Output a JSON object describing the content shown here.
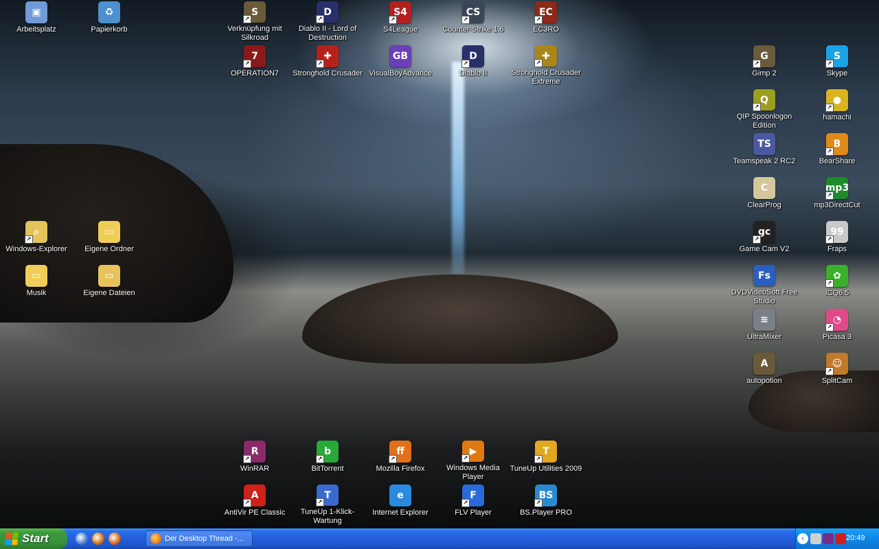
{
  "desktop": {
    "icons": [
      {
        "label": "Arbeitsplatz",
        "glyph": "▣",
        "color": "#6f9bd8",
        "shortcut": false
      },
      {
        "label": "Papierkorb",
        "glyph": "♻",
        "color": "#4e8fd1",
        "shortcut": false
      },
      {
        "label": "Verknüpfung mit Silkroad",
        "glyph": "S",
        "color": "#6b5a3a",
        "shortcut": true
      },
      {
        "label": "Diablo II - Lord of Destruction",
        "glyph": "D",
        "color": "#28306a",
        "shortcut": true
      },
      {
        "label": "S4League",
        "glyph": "S4",
        "color": "#b2211f",
        "shortcut": true
      },
      {
        "label": "Counter-Strike 1.6",
        "glyph": "CS",
        "color": "#3a4658",
        "shortcut": true
      },
      {
        "label": "EC3RO",
        "glyph": "EC",
        "color": "#8c2a18",
        "shortcut": true
      },
      {
        "label": "OPERATION7",
        "glyph": "7",
        "color": "#8a1a1a",
        "shortcut": true
      },
      {
        "label": "Stronghold Crusader",
        "glyph": "✚",
        "color": "#b5221b",
        "shortcut": true
      },
      {
        "label": "VisualBoyAdvance",
        "glyph": "GB",
        "color": "#6a3fb8",
        "shortcut": false
      },
      {
        "label": "Diablo II",
        "glyph": "D",
        "color": "#28306a",
        "shortcut": true
      },
      {
        "label": "Stronghold Crusader Extreme",
        "glyph": "✚",
        "color": "#a8871c",
        "shortcut": true
      },
      {
        "label": "Gimp 2",
        "glyph": "G",
        "color": "#6b5a3c",
        "shortcut": true
      },
      {
        "label": "Skype",
        "glyph": "S",
        "color": "#1aa3e6",
        "shortcut": true
      },
      {
        "label": "QIP Spoonlogon Edition",
        "glyph": "Q",
        "color": "#9aa01e",
        "shortcut": true
      },
      {
        "label": "hamachi",
        "glyph": "●",
        "color": "#d9b320",
        "shortcut": true
      },
      {
        "label": "Teamspeak 2 RC2",
        "glyph": "TS",
        "color": "#4a5aa0",
        "shortcut": false
      },
      {
        "label": "BearShare",
        "glyph": "B",
        "color": "#e08a18",
        "shortcut": true
      },
      {
        "label": "ClearProg",
        "glyph": "C",
        "color": "#d6c79a",
        "shortcut": false
      },
      {
        "label": "mp3DirectCut",
        "glyph": "mp3",
        "color": "#1e8a2a",
        "shortcut": true
      },
      {
        "label": "Windows-Explorer",
        "glyph": "⌕",
        "color": "#e3c45a",
        "shortcut": true
      },
      {
        "label": "Eigene Ordner",
        "glyph": "▭",
        "color": "#f0cd58",
        "shortcut": false
      },
      {
        "label": "Game Cam V2",
        "glyph": "gc",
        "color": "#222222",
        "shortcut": true
      },
      {
        "label": "Fraps",
        "glyph": "99",
        "color": "#c9c9c9",
        "shortcut": true
      },
      {
        "label": "Musik",
        "glyph": "▭",
        "color": "#f0cd58",
        "shortcut": false
      },
      {
        "label": "Eigene Dateien",
        "glyph": "▭",
        "color": "#e8c35c",
        "shortcut": false
      },
      {
        "label": "DVDVideoSoft Free Studio",
        "glyph": "Fs",
        "color": "#2a5fc0",
        "shortcut": false
      },
      {
        "label": "ICQ6.5",
        "glyph": "✿",
        "color": "#3ab02a",
        "shortcut": true
      },
      {
        "label": "UltraMixer",
        "glyph": "≋",
        "color": "#7a7f88",
        "shortcut": false
      },
      {
        "label": "Picasa 3",
        "glyph": "◔",
        "color": "#e04a8a",
        "shortcut": true
      },
      {
        "label": "autopotion",
        "glyph": "A",
        "color": "#6b5a3a",
        "shortcut": false
      },
      {
        "label": "SplitCam",
        "glyph": "☺",
        "color": "#c07a2a",
        "shortcut": true
      },
      {
        "label": "WinRAR",
        "glyph": "R",
        "color": "#8a2a6a",
        "shortcut": true
      },
      {
        "label": "BitTorrent",
        "glyph": "b",
        "color": "#2aa83a",
        "shortcut": true
      },
      {
        "label": "Mozilla Firefox",
        "glyph": "ff",
        "color": "#e0701a",
        "shortcut": true
      },
      {
        "label": "Windows Media Player",
        "glyph": "▶",
        "color": "#e07a10",
        "shortcut": true
      },
      {
        "label": "TuneUp Utilities 2009",
        "glyph": "T",
        "color": "#e0a820",
        "shortcut": true
      },
      {
        "label": "AntiVir PE Classic",
        "glyph": "A",
        "color": "#d0201a",
        "shortcut": true
      },
      {
        "label": "TuneUp 1-Klick-Wartung",
        "glyph": "T",
        "color": "#3a6ad0",
        "shortcut": true
      },
      {
        "label": "Internet Explorer",
        "glyph": "e",
        "color": "#2a8ae0",
        "shortcut": false
      },
      {
        "label": "FLV Player",
        "glyph": "F",
        "color": "#2a6ad8",
        "shortcut": true
      },
      {
        "label": "BS.Player PRO",
        "glyph": "BS",
        "color": "#2a8ad0",
        "shortcut": true
      }
    ]
  },
  "taskbar": {
    "start_label": "Start",
    "quick_launch": [
      {
        "name": "show-desktop",
        "color": "#5a8ad8"
      },
      {
        "name": "windows-media-player",
        "color": "#e07a10"
      },
      {
        "name": "firefox",
        "color": "#e0701a"
      }
    ],
    "task_button_label": "Der Desktop Thread -...",
    "tray": {
      "chevron": "‹",
      "icons": [
        {
          "name": "network",
          "color": "#d0d0d0"
        },
        {
          "name": "volume",
          "color": "#7a2a8a"
        },
        {
          "name": "antivir",
          "color": "#d0201a"
        }
      ],
      "clock": "20:49"
    }
  }
}
